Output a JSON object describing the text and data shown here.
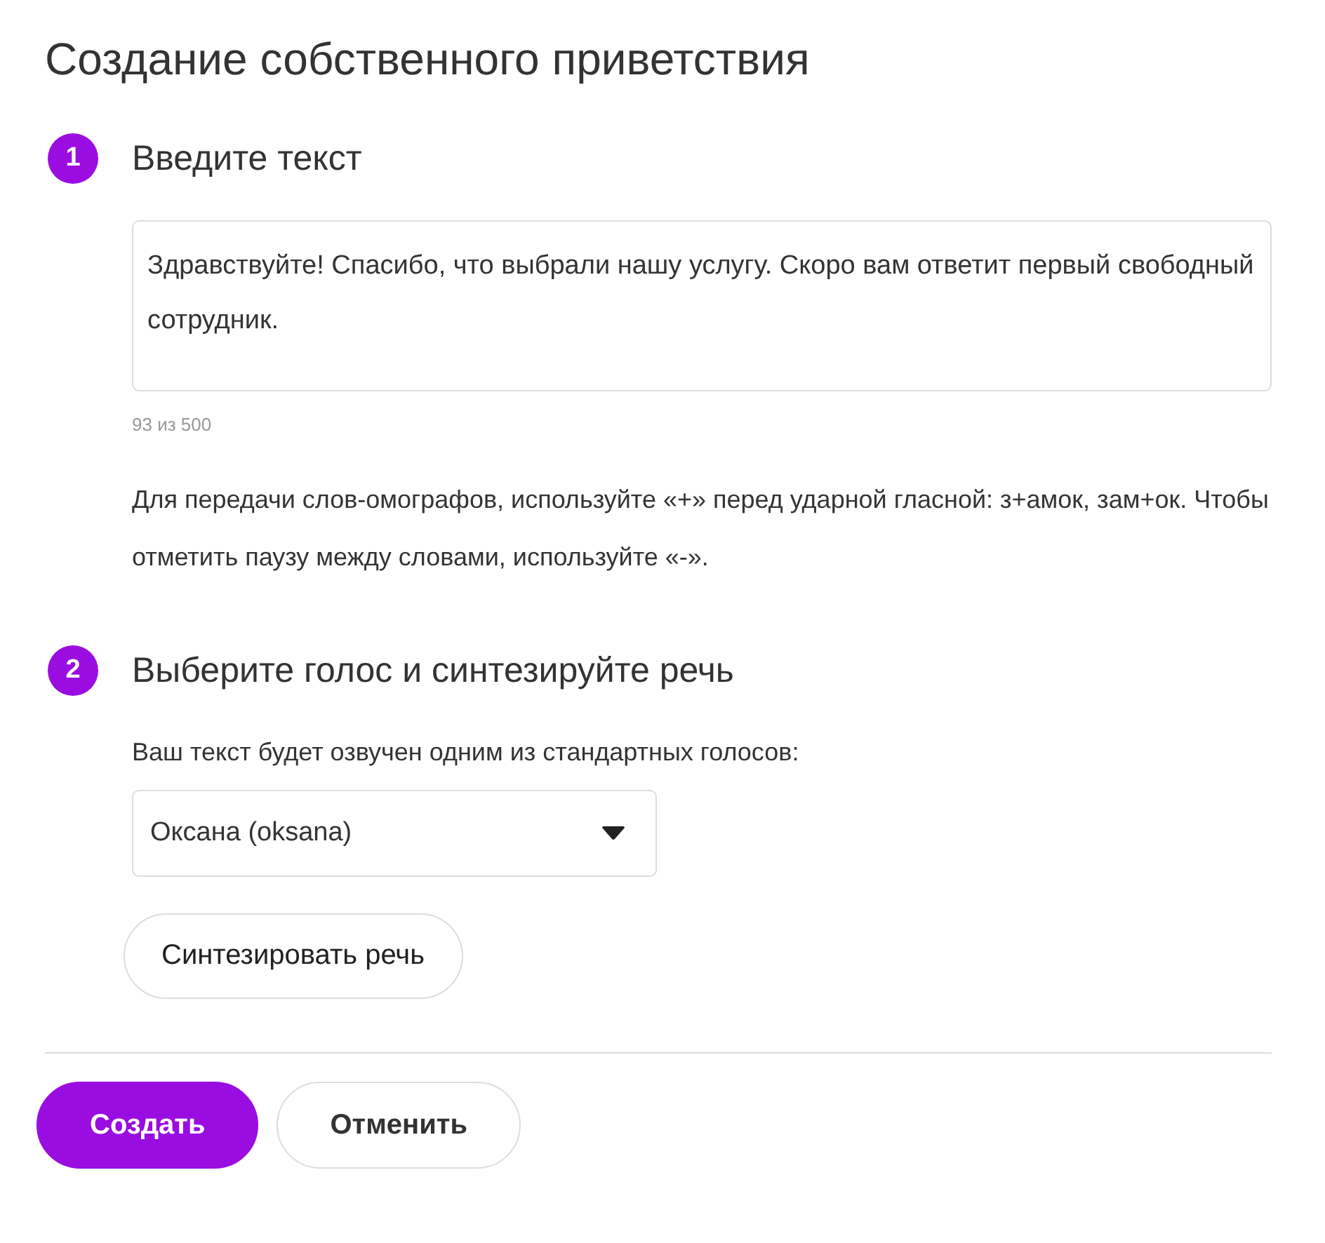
{
  "title": "Создание собственного приветствия",
  "steps": [
    {
      "number": "1",
      "title": "Введите текст",
      "text_field": {
        "value": "Здравствуйте! Спасибо, что выбрали нашу услугу. Скоро вам ответит первый свободный сотрудник.",
        "counter": "93 из 500"
      },
      "hint": "Для передачи слов-омографов, используйте «+» перед ударной гласной: з+амок, зам+ок. Чтобы отметить паузу между словами, используйте «-»."
    },
    {
      "number": "2",
      "title": "Выберите голос и синтезируйте речь",
      "label": "Ваш текст будет озвучен одним из стандартных голосов:",
      "voice_select": {
        "value": "Оксана (oksana)"
      },
      "button": "Синтезировать речь"
    }
  ],
  "buttons": [
    {
      "label": "Создать",
      "kind": "primary"
    },
    {
      "label": "Отменить",
      "kind": "secondary"
    }
  ]
}
